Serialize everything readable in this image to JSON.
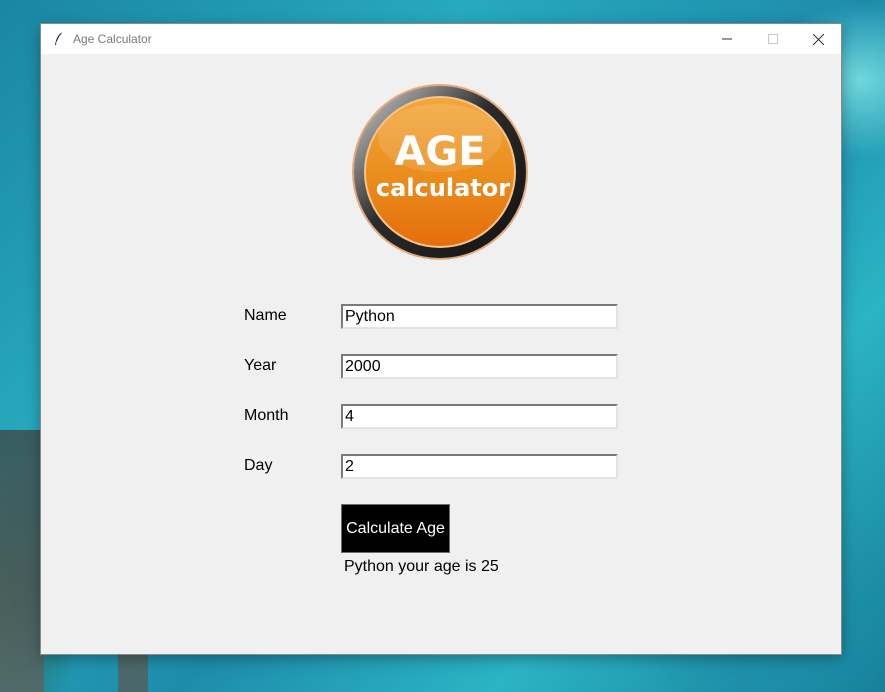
{
  "window": {
    "title": "Age Calculator",
    "controls": {
      "minimize": "minimize",
      "maximize": "maximize",
      "close": "close"
    }
  },
  "logo": {
    "line1": "AGE",
    "line2": "calculator",
    "colors": {
      "top": "#f7b24a",
      "bottom": "#e8730f",
      "ring": "#2a2a2a"
    }
  },
  "form": {
    "name": {
      "label": "Name",
      "value": "Python"
    },
    "year": {
      "label": "Year",
      "value": "2000"
    },
    "month": {
      "label": "Month",
      "value": "4"
    },
    "day": {
      "label": "Day",
      "value": "2"
    }
  },
  "calculate_button": {
    "label": "Calculate Age",
    "bg": "#000000",
    "fg": "#ffffff"
  },
  "result": {
    "text": "Python your age is 25"
  }
}
